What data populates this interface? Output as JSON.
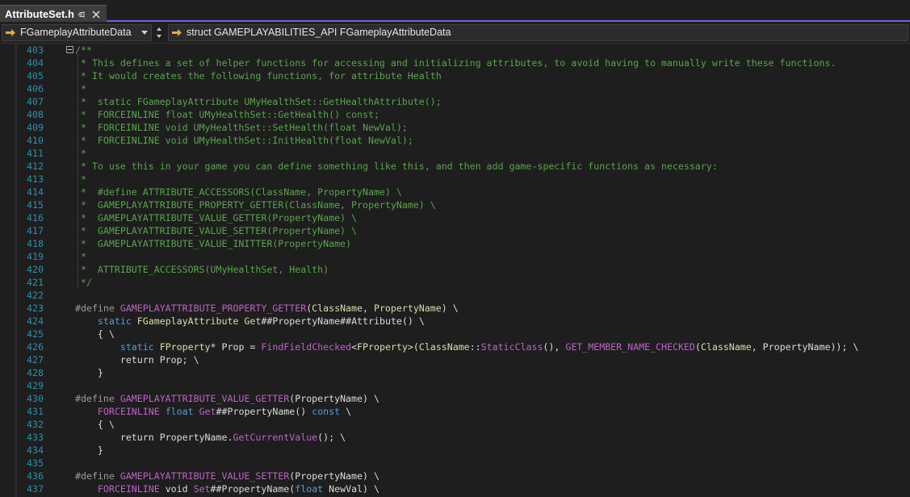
{
  "tab": {
    "title": "AttributeSet.h"
  },
  "nav": {
    "scope": "FGameplayAttributeData",
    "member": "struct GAMEPLAYABILITIES_API FGameplayAttributeData"
  },
  "colors": {
    "accent": "#7160e8",
    "line_number": "#2b91af",
    "comment": "#57a64a",
    "keyword": "#569cd6",
    "macro": "#bd63c5",
    "type": "#4ec9b0",
    "function": "#dcdcaa",
    "plain": "#dcdcdc"
  },
  "code_lines": [
    {
      "num": "403",
      "tokens": [
        {
          "t": "/**",
          "c": "c"
        }
      ]
    },
    {
      "num": "404",
      "tokens": [
        {
          "t": " * This defines a set of helper functions for accessing and initializing attributes, to avoid having to manually write these functions.",
          "c": "c"
        }
      ]
    },
    {
      "num": "405",
      "tokens": [
        {
          "t": " * It would creates the following functions, for attribute Health",
          "c": "c"
        }
      ]
    },
    {
      "num": "406",
      "tokens": [
        {
          "t": " *",
          "c": "c"
        }
      ]
    },
    {
      "num": "407",
      "tokens": [
        {
          "t": " *  static FGameplayAttribute UMyHealthSet::GetHealthAttribute();",
          "c": "c"
        }
      ]
    },
    {
      "num": "408",
      "tokens": [
        {
          "t": " *  FORCEINLINE float UMyHealthSet::GetHealth() const;",
          "c": "c"
        }
      ]
    },
    {
      "num": "409",
      "tokens": [
        {
          "t": " *  FORCEINLINE void UMyHealthSet::SetHealth(float NewVal);",
          "c": "c"
        }
      ]
    },
    {
      "num": "410",
      "tokens": [
        {
          "t": " *  FORCEINLINE void UMyHealthSet::InitHealth(float NewVal);",
          "c": "c"
        }
      ]
    },
    {
      "num": "411",
      "tokens": [
        {
          "t": " *",
          "c": "c"
        }
      ]
    },
    {
      "num": "412",
      "tokens": [
        {
          "t": " * To use this in your game you can define something like this, and then add game-specific functions as necessary:",
          "c": "c"
        }
      ]
    },
    {
      "num": "413",
      "tokens": [
        {
          "t": " *",
          "c": "c"
        }
      ]
    },
    {
      "num": "414",
      "tokens": [
        {
          "t": " *  #define ATTRIBUTE_ACCESSORS(ClassName, PropertyName) \\",
          "c": "c"
        }
      ]
    },
    {
      "num": "415",
      "tokens": [
        {
          "t": " *  GAMEPLAYATTRIBUTE_PROPERTY_GETTER(ClassName, PropertyName) \\",
          "c": "c"
        }
      ]
    },
    {
      "num": "416",
      "tokens": [
        {
          "t": " *  GAMEPLAYATTRIBUTE_VALUE_GETTER(PropertyName) \\",
          "c": "c"
        }
      ]
    },
    {
      "num": "417",
      "tokens": [
        {
          "t": " *  GAMEPLAYATTRIBUTE_VALUE_SETTER(PropertyName) \\",
          "c": "c"
        }
      ]
    },
    {
      "num": "418",
      "tokens": [
        {
          "t": " *  GAMEPLAYATTRIBUTE_VALUE_INITTER(PropertyName)",
          "c": "c"
        }
      ]
    },
    {
      "num": "419",
      "tokens": [
        {
          "t": " *",
          "c": "c"
        }
      ]
    },
    {
      "num": "420",
      "tokens": [
        {
          "t": " *  ATTRIBUTE_ACCESSORS(UMyHealthSet, Health)",
          "c": "c"
        }
      ]
    },
    {
      "num": "421",
      "tokens": [
        {
          "t": " */",
          "c": "c"
        }
      ]
    },
    {
      "num": "422",
      "tokens": []
    },
    {
      "num": "423",
      "tokens": [
        {
          "t": "#define ",
          "c": "pp"
        },
        {
          "t": "GAMEPLAYATTRIBUTE_PROPERTY_GETTER",
          "c": "mac"
        },
        {
          "t": "(",
          "c": "p"
        },
        {
          "t": "ClassName",
          "c": "fn"
        },
        {
          "t": ", ",
          "c": "p"
        },
        {
          "t": "PropertyName",
          "c": "fn"
        },
        {
          "t": ") \\",
          "c": "p"
        }
      ]
    },
    {
      "num": "424",
      "tokens": [
        {
          "t": "    ",
          "c": "p"
        },
        {
          "t": "static ",
          "c": "kw"
        },
        {
          "t": "FGameplayAttribute ",
          "c": "fn"
        },
        {
          "t": "Get",
          "c": "fn"
        },
        {
          "t": "##",
          "c": "p"
        },
        {
          "t": "PropertyName",
          "c": "p"
        },
        {
          "t": "##",
          "c": "p"
        },
        {
          "t": "Attribute",
          "c": "p"
        },
        {
          "t": "() \\",
          "c": "p"
        }
      ]
    },
    {
      "num": "425",
      "tokens": [
        {
          "t": "    { \\",
          "c": "p"
        }
      ]
    },
    {
      "num": "426",
      "tokens": [
        {
          "t": "        ",
          "c": "p"
        },
        {
          "t": "static ",
          "c": "kw"
        },
        {
          "t": "FProperty",
          "c": "fn"
        },
        {
          "t": "* Prop = ",
          "c": "p"
        },
        {
          "t": "FindFieldChecked",
          "c": "mac"
        },
        {
          "t": "<",
          "c": "p"
        },
        {
          "t": "FProperty",
          "c": "fn"
        },
        {
          "t": ">(",
          "c": "p"
        },
        {
          "t": "ClassName",
          "c": "fn"
        },
        {
          "t": "::",
          "c": "p"
        },
        {
          "t": "StaticClass",
          "c": "mac"
        },
        {
          "t": "(), ",
          "c": "p"
        },
        {
          "t": "GET_MEMBER_NAME_CHECKED",
          "c": "mac"
        },
        {
          "t": "(",
          "c": "p"
        },
        {
          "t": "ClassName",
          "c": "fn"
        },
        {
          "t": ", ",
          "c": "p"
        },
        {
          "t": "PropertyName",
          "c": "p"
        },
        {
          "t": ")); \\",
          "c": "p"
        }
      ]
    },
    {
      "num": "427",
      "tokens": [
        {
          "t": "        return ",
          "c": "p"
        },
        {
          "t": "Prop",
          "c": "p"
        },
        {
          "t": "; \\",
          "c": "p"
        }
      ]
    },
    {
      "num": "428",
      "tokens": [
        {
          "t": "    }",
          "c": "p"
        }
      ]
    },
    {
      "num": "429",
      "tokens": []
    },
    {
      "num": "430",
      "tokens": [
        {
          "t": "#define ",
          "c": "pp"
        },
        {
          "t": "GAMEPLAYATTRIBUTE_VALUE_GETTER",
          "c": "mac"
        },
        {
          "t": "(",
          "c": "p"
        },
        {
          "t": "PropertyName",
          "c": "p"
        },
        {
          "t": ") \\",
          "c": "p"
        }
      ]
    },
    {
      "num": "431",
      "tokens": [
        {
          "t": "    ",
          "c": "p"
        },
        {
          "t": "FORCEINLINE ",
          "c": "mac"
        },
        {
          "t": "float ",
          "c": "kw"
        },
        {
          "t": "Get",
          "c": "mac"
        },
        {
          "t": "##",
          "c": "p"
        },
        {
          "t": "PropertyName",
          "c": "p"
        },
        {
          "t": "() ",
          "c": "p"
        },
        {
          "t": "const",
          "c": "kw"
        },
        {
          "t": " \\",
          "c": "p"
        }
      ]
    },
    {
      "num": "432",
      "tokens": [
        {
          "t": "    { \\",
          "c": "p"
        }
      ]
    },
    {
      "num": "433",
      "tokens": [
        {
          "t": "        return ",
          "c": "p"
        },
        {
          "t": "PropertyName",
          "c": "p"
        },
        {
          "t": ".",
          "c": "p"
        },
        {
          "t": "GetCurrentValue",
          "c": "mac"
        },
        {
          "t": "(); \\",
          "c": "p"
        }
      ]
    },
    {
      "num": "434",
      "tokens": [
        {
          "t": "    }",
          "c": "p"
        }
      ]
    },
    {
      "num": "435",
      "tokens": []
    },
    {
      "num": "436",
      "tokens": [
        {
          "t": "#define ",
          "c": "pp"
        },
        {
          "t": "GAMEPLAYATTRIBUTE_VALUE_SETTER",
          "c": "mac"
        },
        {
          "t": "(",
          "c": "p"
        },
        {
          "t": "PropertyName",
          "c": "p"
        },
        {
          "t": ") \\",
          "c": "p"
        }
      ]
    },
    {
      "num": "437",
      "tokens": [
        {
          "t": "    ",
          "c": "p"
        },
        {
          "t": "FORCEINLINE ",
          "c": "mac"
        },
        {
          "t": "void ",
          "c": "p"
        },
        {
          "t": "Set",
          "c": "mac"
        },
        {
          "t": "##",
          "c": "p"
        },
        {
          "t": "PropertyName",
          "c": "p"
        },
        {
          "t": "(",
          "c": "p"
        },
        {
          "t": "float ",
          "c": "kw"
        },
        {
          "t": "NewVal",
          "c": "p"
        },
        {
          "t": ") \\",
          "c": "p"
        }
      ]
    }
  ]
}
